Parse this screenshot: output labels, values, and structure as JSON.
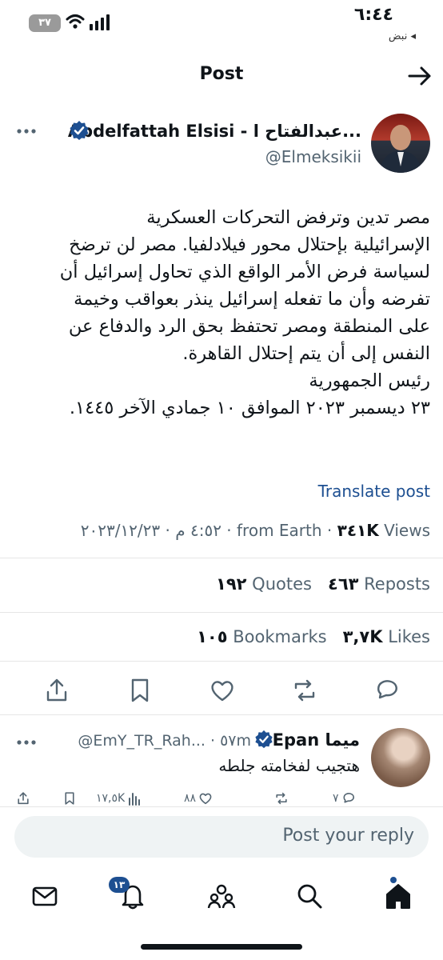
{
  "status_bar": {
    "time": "٦:٤٤",
    "subtitle": "◂ نبض",
    "battery": "٣٧"
  },
  "header": {
    "title": "Post",
    "back_icon": "arrow-right-icon"
  },
  "author": {
    "name": "Abdelfattah Elsisi - عبدالفتاح ا...",
    "handle": "@Elmeksikii",
    "verified": true
  },
  "tweet": {
    "lines": [
      "مصر تدين وترفض التحركات العسكرية",
      "الإسرائيلية بإحتلال محور فيلادلفيا. مصر لن ترضخ",
      "لسياسة فرض الأمر الواقع الذي تحاول إسرائيل أن",
      "تفرضه وأن ما تفعله إسرائيل ينذر بعواقب وخيمة",
      "على المنطقة ومصر تحتفظ بحق الرد والدفاع عن",
      "النفس إلى أن يتم إحتلال القاهرة.",
      "رئيس الجمهورية",
      "٢٣ ديسمبر ٢٠٢٣ الموافق ١٠ جمادي الآخر ١٤٤٥."
    ],
    "translate_label": "Translate post",
    "datetime": "٤:٥٢ م · ٢٠٢٣/١٢/٢٣ · from Earth · ",
    "views_count": "٣٤١K",
    "views_label": " Views"
  },
  "stats": {
    "reposts_count": "٤٦٣",
    "reposts_label": " Reposts",
    "quotes_count": "١٩٢",
    "quotes_label": " Quotes",
    "likes_count": "٣,٧K",
    "likes_label": " Likes",
    "bookmarks_count": "١٠٥",
    "bookmarks_label": " Bookmarks"
  },
  "reply": {
    "name": "ميما Epan",
    "handle": "@EmY_TR_Rah... · ٥٧m",
    "text": "هتجيب لفخامته جلطه",
    "reply_count": "٧",
    "repost_count": "",
    "like_count": "٨٨",
    "views_count": "١٧,٥K"
  },
  "reply_input": {
    "placeholder": "Post your reply"
  },
  "nav": {
    "notifications_badge": "١٣"
  },
  "colors": {
    "accent": "#1d4f91",
    "text": "#0f1419",
    "muted": "#536471",
    "verified": "#1d9bf0"
  }
}
